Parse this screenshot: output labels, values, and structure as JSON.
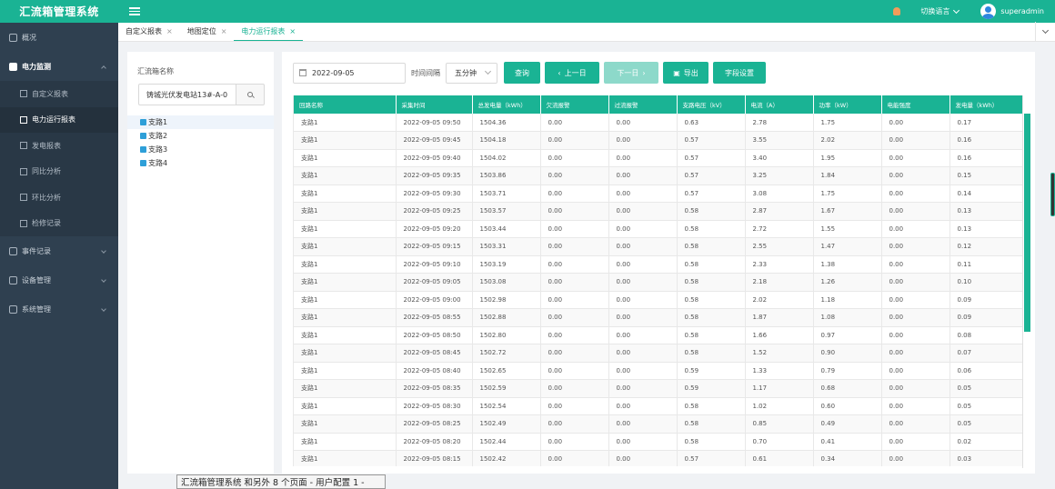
{
  "app": {
    "title": "汇流箱管理系统",
    "language_label": "切换语言",
    "username": "superadmin"
  },
  "colors": {
    "accent": "#1ab394",
    "sidebar_bg": "#2f4050",
    "topbar": "#1ab394"
  },
  "sidebar": {
    "items": [
      {
        "label": "概况",
        "icon": "monitor-icon"
      },
      {
        "label": "电力监测",
        "icon": "power-icon",
        "open": true
      },
      {
        "label": "事件记录",
        "icon": "pencil-icon"
      },
      {
        "label": "设备管理",
        "icon": "grid-icon"
      },
      {
        "label": "系统管理",
        "icon": "settings-icon"
      }
    ],
    "subitems": [
      {
        "label": "自定义报表"
      },
      {
        "label": "电力运行报表",
        "active": true
      },
      {
        "label": "发电报表"
      },
      {
        "label": "同比分析"
      },
      {
        "label": "环比分析"
      },
      {
        "label": "检修记录"
      }
    ]
  },
  "tabs": [
    {
      "label": "自定义报表",
      "close": "×"
    },
    {
      "label": "地图定位",
      "close": "×"
    },
    {
      "label": "电力运行报表",
      "close": "×",
      "active": true
    }
  ],
  "left_panel": {
    "title": "汇流箱名称",
    "search_value": "铸城光伏发电站13#-A-0",
    "tree": [
      "支路1",
      "支路2",
      "支路3",
      "支路4"
    ]
  },
  "toolbar": {
    "date": "2022-09-05",
    "interval_label": "时间间隔",
    "interval_value": "五分钟",
    "query": "查询",
    "prev_day": "上一日",
    "next_day": "下一日",
    "export": "导出",
    "fields": "字段设置"
  },
  "table": {
    "columns": [
      "回路名称",
      "采集时间",
      "总发电量（kWh）",
      "欠流报警",
      "过流报警",
      "支路电压（kV）",
      "电流（A）",
      "功率（kW）",
      "电能强度",
      "发电量（kWh）"
    ],
    "rows": [
      [
        "支路1",
        "2022-09-05 09:50",
        "1504.36",
        "0.00",
        "0.00",
        "0.63",
        "2.78",
        "1.75",
        "0.00",
        "0.17"
      ],
      [
        "支路1",
        "2022-09-05 09:45",
        "1504.18",
        "0.00",
        "0.00",
        "0.57",
        "3.55",
        "2.02",
        "0.00",
        "0.16"
      ],
      [
        "支路1",
        "2022-09-05 09:40",
        "1504.02",
        "0.00",
        "0.00",
        "0.57",
        "3.40",
        "1.95",
        "0.00",
        "0.16"
      ],
      [
        "支路1",
        "2022-09-05 09:35",
        "1503.86",
        "0.00",
        "0.00",
        "0.57",
        "3.25",
        "1.84",
        "0.00",
        "0.15"
      ],
      [
        "支路1",
        "2022-09-05 09:30",
        "1503.71",
        "0.00",
        "0.00",
        "0.57",
        "3.08",
        "1.75",
        "0.00",
        "0.14"
      ],
      [
        "支路1",
        "2022-09-05 09:25",
        "1503.57",
        "0.00",
        "0.00",
        "0.58",
        "2.87",
        "1.67",
        "0.00",
        "0.13"
      ],
      [
        "支路1",
        "2022-09-05 09:20",
        "1503.44",
        "0.00",
        "0.00",
        "0.58",
        "2.72",
        "1.55",
        "0.00",
        "0.13"
      ],
      [
        "支路1",
        "2022-09-05 09:15",
        "1503.31",
        "0.00",
        "0.00",
        "0.58",
        "2.55",
        "1.47",
        "0.00",
        "0.12"
      ],
      [
        "支路1",
        "2022-09-05 09:10",
        "1503.19",
        "0.00",
        "0.00",
        "0.58",
        "2.33",
        "1.38",
        "0.00",
        "0.11"
      ],
      [
        "支路1",
        "2022-09-05 09:05",
        "1503.08",
        "0.00",
        "0.00",
        "0.58",
        "2.18",
        "1.26",
        "0.00",
        "0.10"
      ],
      [
        "支路1",
        "2022-09-05 09:00",
        "1502.98",
        "0.00",
        "0.00",
        "0.58",
        "2.02",
        "1.18",
        "0.00",
        "0.09"
      ],
      [
        "支路1",
        "2022-09-05 08:55",
        "1502.88",
        "0.00",
        "0.00",
        "0.58",
        "1.87",
        "1.08",
        "0.00",
        "0.09"
      ],
      [
        "支路1",
        "2022-09-05 08:50",
        "1502.80",
        "0.00",
        "0.00",
        "0.58",
        "1.66",
        "0.97",
        "0.00",
        "0.08"
      ],
      [
        "支路1",
        "2022-09-05 08:45",
        "1502.72",
        "0.00",
        "0.00",
        "0.58",
        "1.52",
        "0.90",
        "0.00",
        "0.07"
      ],
      [
        "支路1",
        "2022-09-05 08:40",
        "1502.65",
        "0.00",
        "0.00",
        "0.59",
        "1.33",
        "0.79",
        "0.00",
        "0.06"
      ],
      [
        "支路1",
        "2022-09-05 08:35",
        "1502.59",
        "0.00",
        "0.00",
        "0.59",
        "1.17",
        "0.68",
        "0.00",
        "0.05"
      ],
      [
        "支路1",
        "2022-09-05 08:30",
        "1502.54",
        "0.00",
        "0.00",
        "0.58",
        "1.02",
        "0.60",
        "0.00",
        "0.05"
      ],
      [
        "支路1",
        "2022-09-05 08:25",
        "1502.49",
        "0.00",
        "0.00",
        "0.58",
        "0.85",
        "0.49",
        "0.00",
        "0.05"
      ],
      [
        "支路1",
        "2022-09-05 08:20",
        "1502.44",
        "0.00",
        "0.00",
        "0.58",
        "0.70",
        "0.41",
        "0.00",
        "0.02"
      ],
      [
        "支路1",
        "2022-09-05 08:15",
        "1502.42",
        "0.00",
        "0.00",
        "0.57",
        "0.61",
        "0.34",
        "0.00",
        "0.03"
      ]
    ]
  },
  "tooltip": "汇流箱管理系统 和另外 8 个页面 - 用户配置 1 -"
}
